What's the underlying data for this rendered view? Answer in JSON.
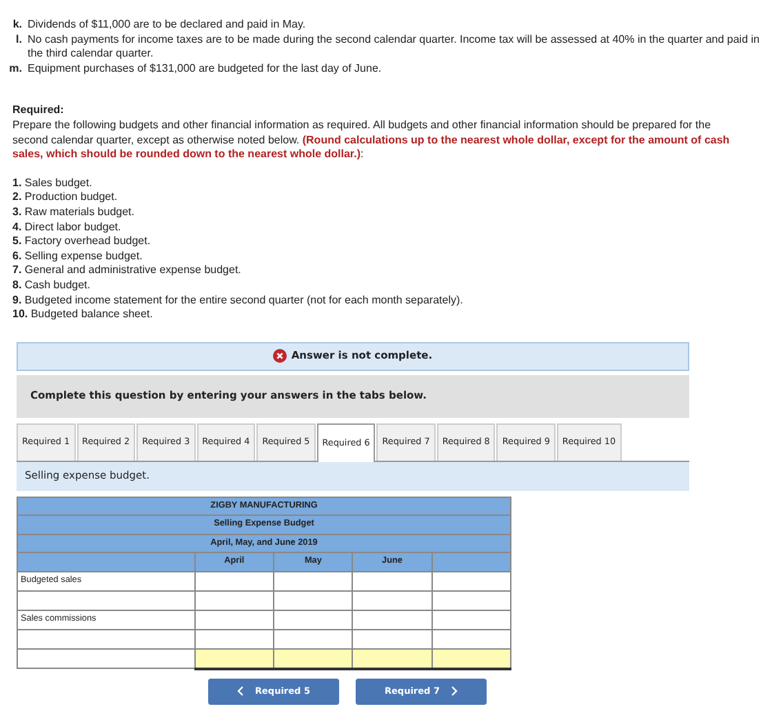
{
  "conditions": [
    {
      "letter": "k.",
      "text": "Dividends of $11,000 are to be declared and paid in May."
    },
    {
      "letter": "l.",
      "text": "No cash payments for income taxes are to be made during the second calendar quarter. Income tax will be assessed at 40% in the quarter and paid in the third calendar quarter."
    },
    {
      "letter": "m.",
      "text": "Equipment purchases of $131,000 are budgeted for the last day of June."
    }
  ],
  "required": {
    "heading": "Required:",
    "text": "Prepare the following budgets and other financial information as required. All budgets and other financial information should be prepared for the second calendar quarter, except as otherwise noted below. **(Round calculations up to the nearest whole dollar, except for the amount of cash sales, which should be rounded down to the nearest whole dollar.)**:",
    "items": [
      {
        "number": "1.",
        "text": "Sales budget."
      },
      {
        "number": "2.",
        "text": "Production budget."
      },
      {
        "number": "3.",
        "text": "Raw materials budget."
      },
      {
        "number": "4.",
        "text": "Direct labor budget."
      },
      {
        "number": "5.",
        "text": "Factory overhead budget."
      },
      {
        "number": "6.",
        "text": "Selling expense budget."
      },
      {
        "number": "7.",
        "text": "General and administrative expense budget."
      },
      {
        "number": "8.",
        "text": "Cash budget."
      },
      {
        "number": "9.",
        "text": "Budgeted income statement for the entire second quarter (not for each month separately)."
      },
      {
        "number": "10.",
        "text": "Budgeted balance sheet."
      }
    ]
  },
  "status_banner": {
    "text": "Answer is not complete."
  },
  "instruction": "Complete this question by entering your answers in the tabs below.",
  "tabs": [
    {
      "label": "Required 1",
      "selected": false
    },
    {
      "label": "Required 2",
      "selected": false
    },
    {
      "label": "Required 3",
      "selected": false
    },
    {
      "label": "Required 4",
      "selected": false
    },
    {
      "label": "Required 5",
      "selected": false
    },
    {
      "label": "Required 6",
      "selected": true
    },
    {
      "label": "Required 7",
      "selected": false
    },
    {
      "label": "Required 8",
      "selected": false
    },
    {
      "label": "Required 9",
      "selected": false
    },
    {
      "label": "Required 10",
      "selected": false
    }
  ],
  "tab_prompt": "Selling expense budget.",
  "table": {
    "title_lines": [
      "ZIGBY MANUFACTURING",
      "Selling Expense Budget",
      "April, May, and June 2019"
    ],
    "columns": [
      "April",
      "May",
      "June"
    ],
    "extra_blank_column": true,
    "rows": [
      {
        "kind": "input",
        "label": "Budgeted sales"
      },
      {
        "kind": "input"
      },
      {
        "kind": "input",
        "label": "Sales commissions"
      },
      {
        "kind": "input"
      },
      {
        "kind": "total"
      }
    ]
  },
  "nav_buttons": [
    {
      "kind": "prev",
      "label": "Required 5"
    },
    {
      "kind": "next",
      "label": "Required 7"
    }
  ]
}
